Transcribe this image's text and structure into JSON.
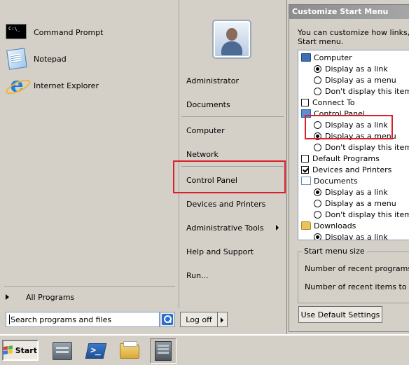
{
  "start_menu": {
    "programs": [
      {
        "label": "Command Prompt",
        "icon": "command-prompt-icon"
      },
      {
        "label": "Notepad",
        "icon": "notepad-icon"
      },
      {
        "label": "Internet Explorer",
        "icon": "internet-explorer-icon"
      }
    ],
    "all_programs_label": "All Programs",
    "search": {
      "placeholder": "Search programs and files",
      "value": "Search programs and files"
    },
    "right_items": [
      {
        "label": "Administrator"
      },
      {
        "label": "Documents"
      },
      {
        "label": "Computer"
      },
      {
        "label": "Network"
      },
      {
        "label": "Control Panel"
      },
      {
        "label": "Devices and Printers"
      },
      {
        "label": "Administrative Tools"
      },
      {
        "label": "Help and Support"
      },
      {
        "label": "Run..."
      }
    ],
    "logoff_label": "Log off"
  },
  "dialog": {
    "title": "Customize Start Menu",
    "description": "You can customize how links, icons, and menus look and behave in the Start menu.",
    "description_line1": "You can customize how links, icon",
    "description_line2": "Start menu.",
    "options": [
      {
        "kind": "header",
        "label": "Computer",
        "icon": "computer-icon"
      },
      {
        "kind": "radio",
        "label": "Display as a link",
        "checked": true
      },
      {
        "kind": "radio",
        "label": "Display as a menu",
        "checked": false
      },
      {
        "kind": "radio",
        "label": "Don't display this item",
        "checked": false
      },
      {
        "kind": "check",
        "label": "Connect To",
        "checked": false
      },
      {
        "kind": "header",
        "label": "Control Panel",
        "icon": "control-panel-icon"
      },
      {
        "kind": "radio",
        "label": "Display as a link",
        "checked": false
      },
      {
        "kind": "radio",
        "label": "Display as a menu",
        "checked": true
      },
      {
        "kind": "radio",
        "label": "Don't display this item",
        "checked": false
      },
      {
        "kind": "check",
        "label": "Default Programs",
        "checked": false
      },
      {
        "kind": "check",
        "label": "Devices and Printers",
        "checked": true
      },
      {
        "kind": "header",
        "label": "Documents",
        "icon": "documents-icon"
      },
      {
        "kind": "radio",
        "label": "Display as a link",
        "checked": true
      },
      {
        "kind": "radio",
        "label": "Display as a menu",
        "checked": false
      },
      {
        "kind": "radio",
        "label": "Don't display this item",
        "checked": false
      },
      {
        "kind": "header",
        "label": "Downloads",
        "icon": "folder-icon"
      },
      {
        "kind": "radio",
        "label": "Display as a link",
        "checked": true
      }
    ],
    "menu_size_title": "Start menu size",
    "recent_programs_label": "Number of recent programs to",
    "recent_items_label": "Number of recent items to displ",
    "default_settings_label": "Use Default Settings"
  },
  "taskbar": {
    "start_label": "Start",
    "pinned": [
      {
        "name": "server-manager-icon"
      },
      {
        "name": "powershell-icon"
      },
      {
        "name": "windows-explorer-icon"
      },
      {
        "name": "task-manager-icon"
      }
    ]
  },
  "colors": {
    "highlight": "#d9202a",
    "accent": "#2a6fd0"
  }
}
